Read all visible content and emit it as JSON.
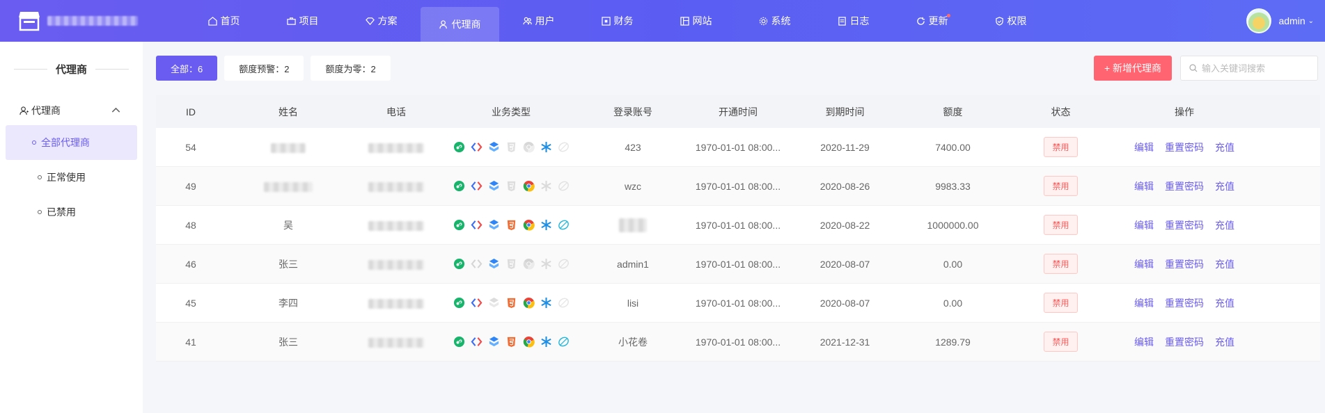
{
  "nav": {
    "items": [
      {
        "label": "首页",
        "icon": "home-icon"
      },
      {
        "label": "项目",
        "icon": "briefcase-icon"
      },
      {
        "label": "方案",
        "icon": "diamond-icon"
      },
      {
        "label": "代理商",
        "icon": "users-icon",
        "active": true
      },
      {
        "label": "用户",
        "icon": "user-group-icon"
      },
      {
        "label": "财务",
        "icon": "finance-icon"
      },
      {
        "label": "网站",
        "icon": "website-icon"
      },
      {
        "label": "系统",
        "icon": "gear-icon"
      },
      {
        "label": "日志",
        "icon": "log-icon"
      },
      {
        "label": "更新",
        "icon": "refresh-icon",
        "dot": true
      },
      {
        "label": "权限",
        "icon": "shield-icon"
      }
    ]
  },
  "user": {
    "name": "admin"
  },
  "sidebar": {
    "title": "代理商",
    "group_label": "代理商",
    "items": [
      {
        "label": "全部代理商",
        "active": true
      },
      {
        "label": "正常使用"
      },
      {
        "label": "已禁用"
      }
    ]
  },
  "filters": [
    {
      "label": "全部：6",
      "active": true
    },
    {
      "label": "额度预警：2"
    },
    {
      "label": "额度为零：2"
    }
  ],
  "add_button": "+ 新增代理商",
  "search": {
    "placeholder": "输入关键词搜索"
  },
  "table": {
    "headers": {
      "id": "ID",
      "name": "姓名",
      "phone": "电话",
      "biz": "业务类型",
      "account": "登录账号",
      "start": "开通时间",
      "end": "到期时间",
      "quota": "额度",
      "status": "状态",
      "ops": "操作"
    },
    "ops": {
      "edit": "编辑",
      "reset": "重置密码",
      "recharge": "充值"
    },
    "rows": [
      {
        "id": "54",
        "name": "",
        "account": "423",
        "start": "1970-01-01 08:00...",
        "end": "2020-11-29",
        "quota": "7400.00",
        "status": "禁用",
        "biz": [
          1,
          1,
          1,
          0,
          0,
          1,
          0
        ]
      },
      {
        "id": "49",
        "name": "",
        "account": "wzc",
        "start": "1970-01-01 08:00...",
        "end": "2020-08-26",
        "quota": "9983.33",
        "status": "禁用",
        "biz": [
          1,
          1,
          1,
          0,
          1,
          0,
          0
        ]
      },
      {
        "id": "48",
        "name": "吴",
        "account": "",
        "start": "1970-01-01 08:00...",
        "end": "2020-08-22",
        "quota": "1000000.00",
        "status": "禁用",
        "biz": [
          1,
          1,
          1,
          1,
          1,
          1,
          1
        ]
      },
      {
        "id": "46",
        "name": "张三",
        "account": "admin1",
        "start": "1970-01-01 08:00...",
        "end": "2020-08-07",
        "quota": "0.00",
        "status": "禁用",
        "biz": [
          1,
          0,
          1,
          0,
          0,
          0,
          0
        ]
      },
      {
        "id": "45",
        "name": "李四",
        "account": "lisi",
        "start": "1970-01-01 08:00...",
        "end": "2020-08-07",
        "quota": "0.00",
        "status": "禁用",
        "biz": [
          1,
          1,
          0,
          1,
          1,
          1,
          0
        ]
      },
      {
        "id": "41",
        "name": "张三",
        "account": "小花卷",
        "start": "1970-01-01 08:00...",
        "end": "2021-12-31",
        "quota": "1289.79",
        "status": "禁用",
        "biz": [
          1,
          1,
          1,
          1,
          1,
          1,
          1
        ]
      }
    ]
  },
  "colors": {
    "primary": "#6a5cf0",
    "danger": "#ff6470"
  },
  "biz_icons": [
    "link-icon",
    "code-icon",
    "layers-icon",
    "html5-icon",
    "chrome-icon",
    "asterisk-icon",
    "leaf-icon"
  ]
}
